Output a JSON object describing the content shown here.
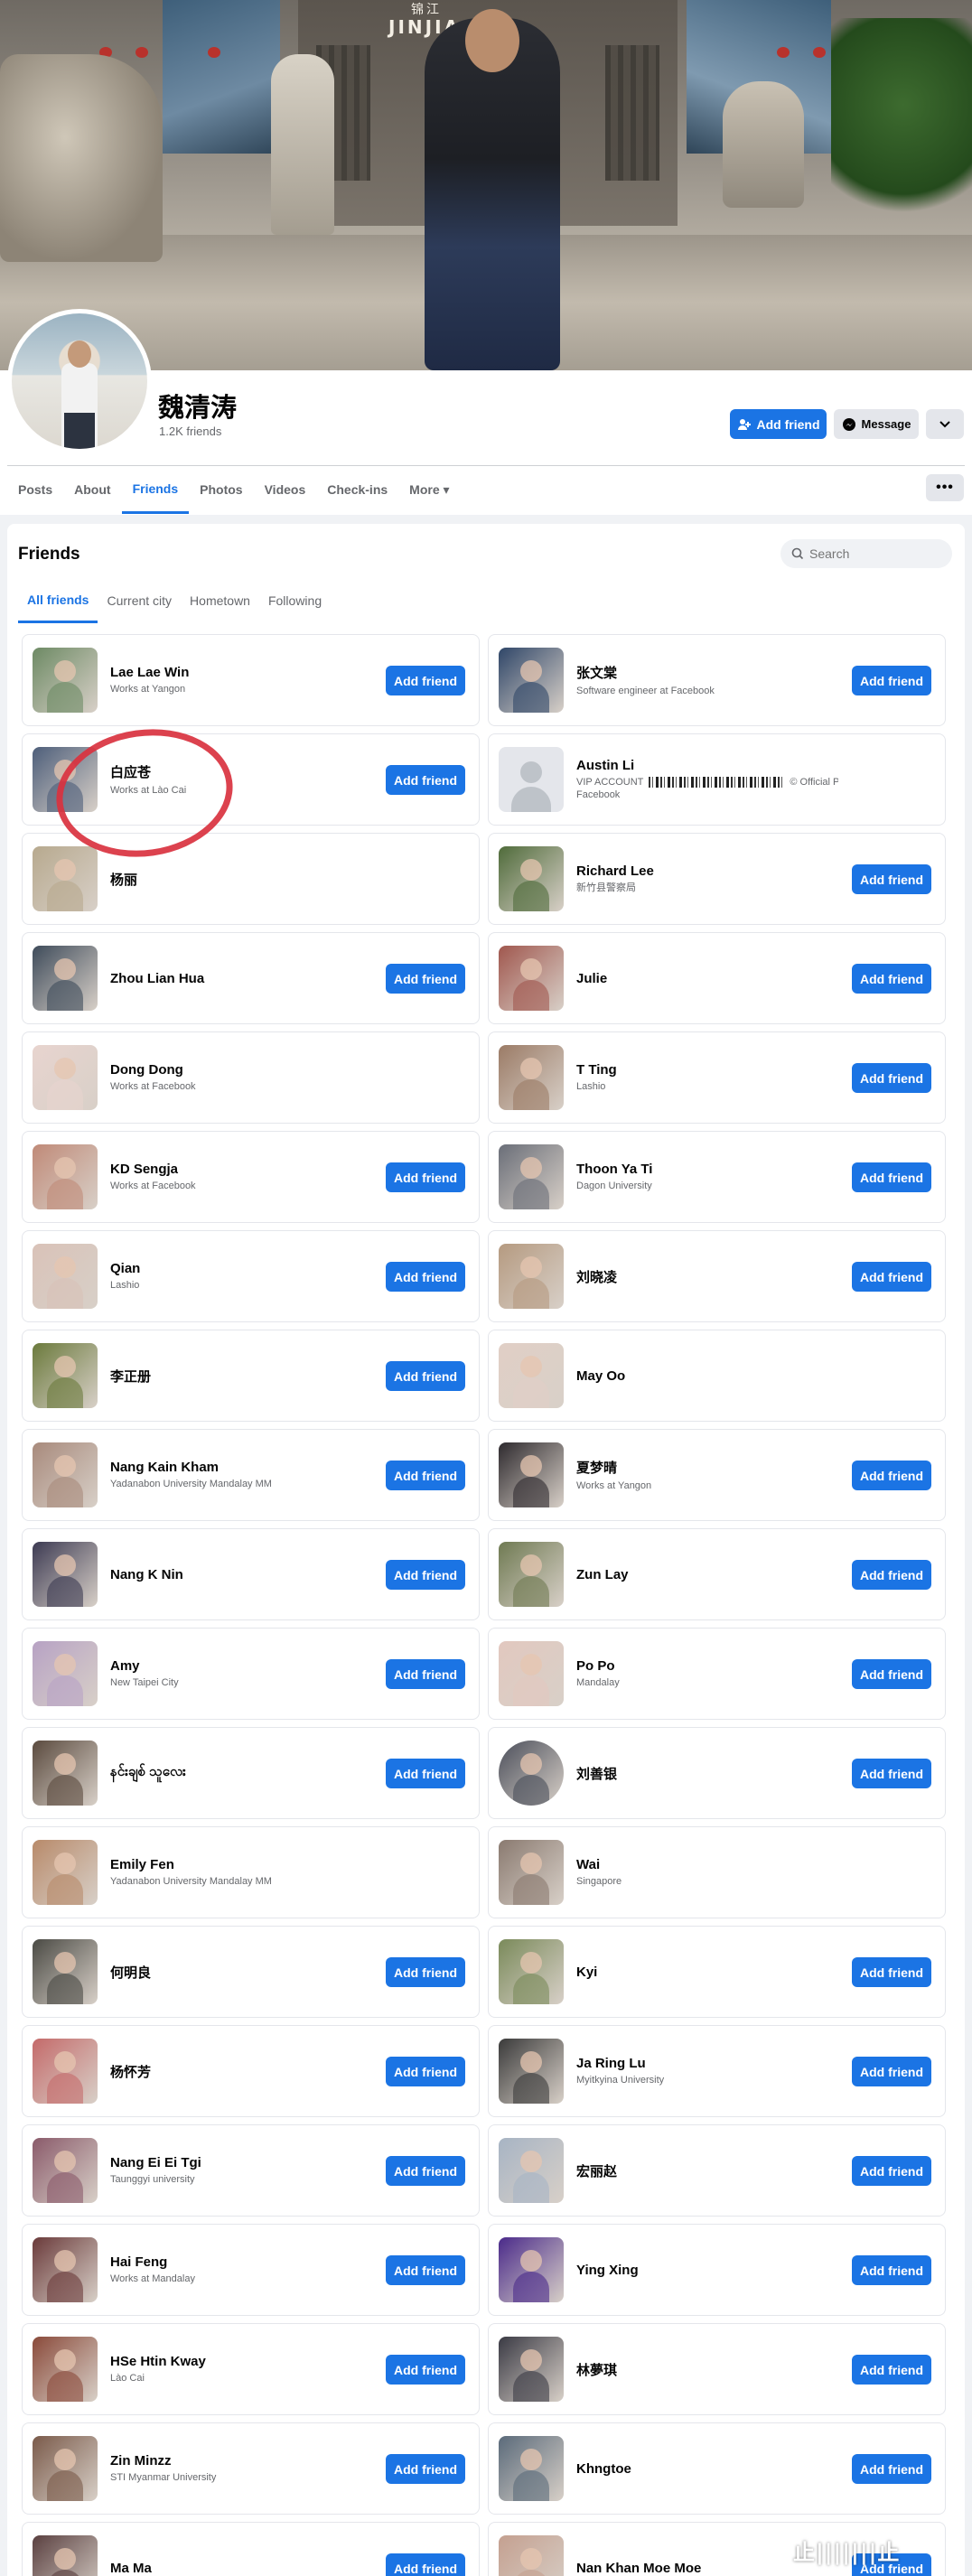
{
  "cover": {
    "sign_line1": "锦江",
    "sign_line2": "JINJIA  TEL"
  },
  "profile": {
    "name": "魏清涛",
    "friends_count": "1.2K friends"
  },
  "header_buttons": {
    "add_friend": "Add friend",
    "message": "Message",
    "more_icon": "chevron-down-icon"
  },
  "tabs": [
    {
      "label": "Posts",
      "active": false
    },
    {
      "label": "About",
      "active": false
    },
    {
      "label": "Friends",
      "active": true
    },
    {
      "label": "Photos",
      "active": false
    },
    {
      "label": "Videos",
      "active": false
    },
    {
      "label": "Check-ins",
      "active": false
    },
    {
      "label": "More ▾",
      "active": false
    }
  ],
  "friends_section": {
    "title": "Friends",
    "search_placeholder": "Search",
    "subtabs": [
      {
        "label": "All friends",
        "active": true
      },
      {
        "label": "Current city",
        "active": false
      },
      {
        "label": "Hometown",
        "active": false
      },
      {
        "label": "Following",
        "active": false
      }
    ],
    "add_friend_label": "Add friend"
  },
  "friends": [
    {
      "name": "Lae Lae Win",
      "sub": "Works at Yangon",
      "button": true,
      "color": "#6d8a64"
    },
    {
      "name": "张文棠",
      "sub": "Software engineer at Facebook",
      "button": true,
      "color": "#2f4668"
    },
    {
      "name": "白应苍",
      "sub": "Works at Lào Cai",
      "button": true,
      "color": "#4d5e7a"
    },
    {
      "name": "Austin Li",
      "sub": "VIP ACCOUNT",
      "sub2": "© Official Profile... at Facebook",
      "button": false,
      "placeholder": true
    },
    {
      "name": "杨丽",
      "sub": "",
      "button": false,
      "color": "#b7a98e"
    },
    {
      "name": "Richard Lee",
      "sub": "新竹县警察局",
      "button": true,
      "color": "#4f6b3a"
    },
    {
      "name": "Zhou Lian Hua",
      "sub": "",
      "button": true,
      "color": "#3e4b5a"
    },
    {
      "name": "Julie",
      "sub": "",
      "button": true,
      "color": "#a0574e"
    },
    {
      "name": "Dong Dong",
      "sub": "Works at Facebook",
      "button": false,
      "color": "#e8d4cf"
    },
    {
      "name": "T Ting",
      "sub": "Lashio",
      "button": true,
      "color": "#9b7b66"
    },
    {
      "name": "KD Sengja",
      "sub": "Works at Facebook",
      "button": true,
      "color": "#c08a78"
    },
    {
      "name": "Thoon Ya Ti",
      "sub": "Dagon University",
      "button": true,
      "color": "#6a6e78"
    },
    {
      "name": "Qian",
      "sub": "Lashio",
      "button": true,
      "color": "#d9c2b8"
    },
    {
      "name": "刘晓凌",
      "sub": "",
      "button": true,
      "color": "#b59a80"
    },
    {
      "name": "李正册",
      "sub": "",
      "button": true,
      "color": "#6b7a3c"
    },
    {
      "name": "May Oo",
      "sub": "",
      "button": false,
      "color": "#e1cfc6"
    },
    {
      "name": "Nang Kain Kham",
      "sub": "Yadanabon University Mandalay MM",
      "button": true,
      "color": "#a88a7c"
    },
    {
      "name": "夏梦晴",
      "sub": "Works at Yangon",
      "button": true,
      "color": "#2e2a2e"
    },
    {
      "name": "Nang K Nin",
      "sub": "",
      "button": true,
      "color": "#3c3a52"
    },
    {
      "name": "Zun Lay",
      "sub": "",
      "button": true,
      "color": "#6f7a52"
    },
    {
      "name": "Amy",
      "sub": "New Taipei City",
      "button": true,
      "color": "#b7a2c4"
    },
    {
      "name": "Po Po",
      "sub": "Mandalay",
      "button": true,
      "color": "#e2c8bf"
    },
    {
      "name": "နင်းချစ် သူလေး",
      "sub": "",
      "button": true,
      "color": "#5a4a3e"
    },
    {
      "name": "刘善银",
      "sub": "",
      "button": true,
      "color": "#4a4e5a",
      "round": true
    },
    {
      "name": "Emily Fen",
      "sub": "Yadanabon University Mandalay MM",
      "button": false,
      "color": "#b88a6a"
    },
    {
      "name": "Wai",
      "sub": "Singapore",
      "button": false,
      "color": "#8a7a70"
    },
    {
      "name": "何明良",
      "sub": "",
      "button": true,
      "color": "#4a4a44"
    },
    {
      "name": "Kyi",
      "sub": "",
      "button": true,
      "color": "#7a8a5a"
    },
    {
      "name": "杨怀芳",
      "sub": "",
      "button": true,
      "color": "#c46a6a"
    },
    {
      "name": "Ja Ring Lu",
      "sub": "Myitkyina University",
      "button": true,
      "color": "#3a3a3a"
    },
    {
      "name": "Nang Ei Ei Tgi",
      "sub": "Taunggyi university",
      "button": true,
      "color": "#8a5a6a"
    },
    {
      "name": "宏丽赵",
      "sub": "",
      "button": true,
      "color": "#a7b4c4"
    },
    {
      "name": "Hai Feng",
      "sub": "Works at Mandalay",
      "button": true,
      "color": "#6a3a3a"
    },
    {
      "name": "Ying Xing",
      "sub": "",
      "button": true,
      "color": "#4a2a8a"
    },
    {
      "name": "HSe Htin Kway",
      "sub": "Lào Cai",
      "button": true,
      "color": "#8a4a3a"
    },
    {
      "name": "林夢琪",
      "sub": "",
      "button": true,
      "color": "#3a3a44"
    },
    {
      "name": "Zin Minzz",
      "sub": "STI Myanmar University",
      "button": true,
      "color": "#7a5a4a"
    },
    {
      "name": "Khngtoe",
      "sub": "",
      "button": true,
      "color": "#5a6a7a"
    },
    {
      "name": "Ma Ma",
      "sub": "",
      "button": true,
      "color": "#5a4040"
    },
    {
      "name": "Nan Khan Moe Moe",
      "sub": "",
      "button": true,
      "color": "#c4a090"
    }
  ],
  "watermark": "止|||||||止"
}
